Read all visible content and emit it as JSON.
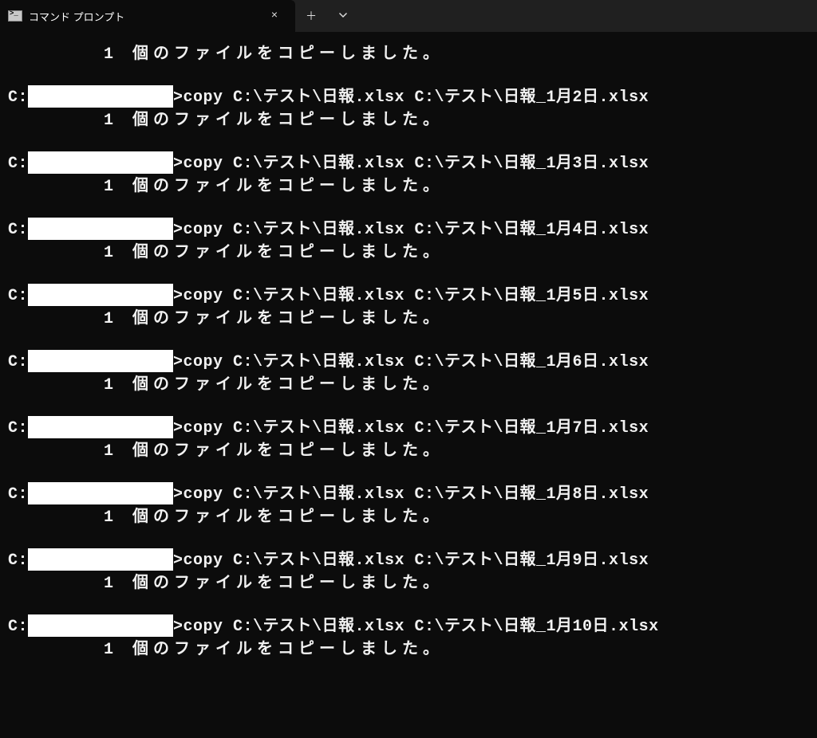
{
  "titlebar": {
    "tab_title": "コマンド プロンプト",
    "close_glyph": "×",
    "new_tab_glyph": "＋"
  },
  "terminal": {
    "drive_prefix": "C:",
    "prompt_char": ">",
    "copy_cmd": "copy",
    "src_path": "C:\\テスト\\日報.xlsx",
    "dest_prefix": "C:\\テスト\\日報_",
    "dest_ext": ".xlsx",
    "result_line": "1 個のファイルをコピーしました。",
    "entries": [
      {
        "suffix": null
      },
      {
        "suffix": "1月2日"
      },
      {
        "suffix": "1月3日"
      },
      {
        "suffix": "1月4日"
      },
      {
        "suffix": "1月5日"
      },
      {
        "suffix": "1月6日"
      },
      {
        "suffix": "1月7日"
      },
      {
        "suffix": "1月8日"
      },
      {
        "suffix": "1月9日"
      },
      {
        "suffix": "1月10日"
      }
    ]
  }
}
